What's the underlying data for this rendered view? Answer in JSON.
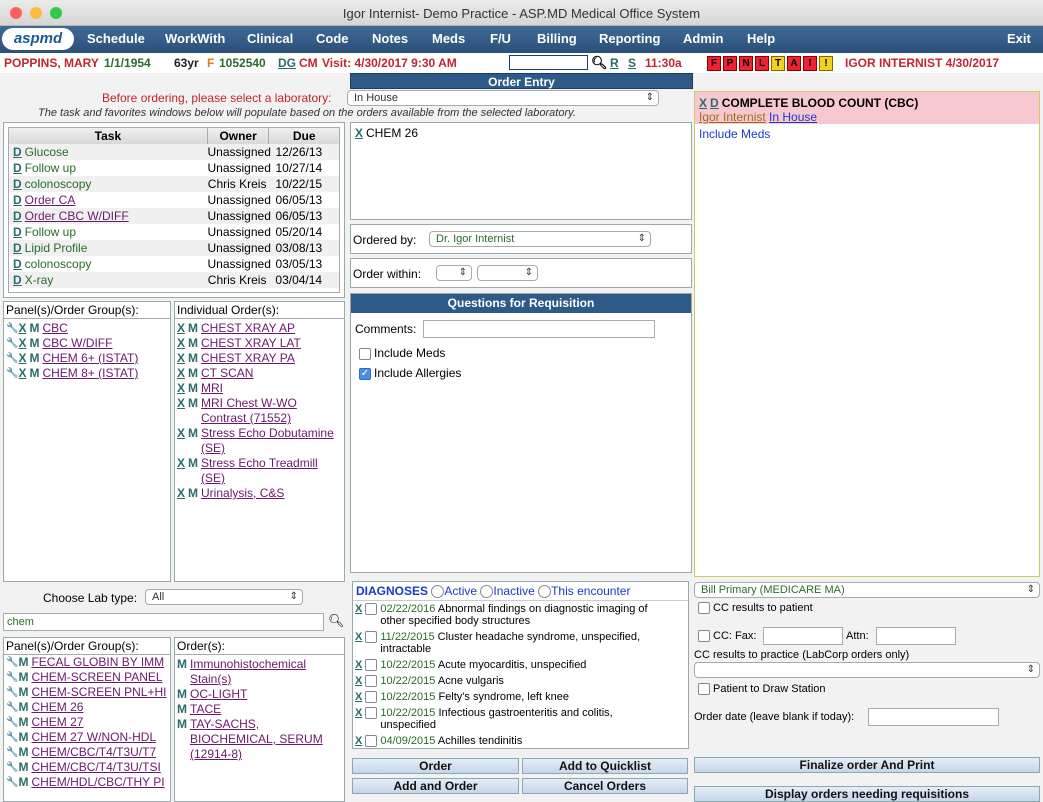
{
  "window": {
    "title": "Igor Internist- Demo Practice - ASP.MD Medical Office System"
  },
  "logo": "aspmd",
  "menu": [
    "Schedule",
    "WorkWith",
    "Clinical",
    "Code",
    "Notes",
    "Meds",
    "F/U",
    "Billing",
    "Reporting",
    "Admin",
    "Help",
    "Exit"
  ],
  "patient": {
    "name": "POPPINS, MARY",
    "dob": "1/1/1954",
    "age": "63yr",
    "sex": "F",
    "id": "1052540",
    "dg": "DG",
    "cm": "CM",
    "visit": "Visit: 4/30/2017 9:30 AM",
    "r": "R",
    "s": "S",
    "time": "11:30a",
    "flags": [
      "F",
      "P",
      "N",
      "L",
      "T",
      "A",
      "I",
      "!"
    ],
    "provider": "IGOR INTERNIST 4/30/2017"
  },
  "order_entry": {
    "title": "Order Entry",
    "lab_prompt": "Before ordering, please select a laboratory:",
    "lab_value": "In House",
    "lab_note": "The task and favorites windows below will populate based on the orders available from the selected laboratory."
  },
  "task_table": {
    "headers": [
      "Task",
      "Owner",
      "Due"
    ],
    "rows": [
      {
        "task": "Glucose",
        "owner": "Unassigned",
        "due": "12/26/13",
        "link": false
      },
      {
        "task": "Follow up",
        "owner": "Unassigned",
        "due": "10/27/14",
        "link": false
      },
      {
        "task": "colonoscopy",
        "owner": "Chris Kreis",
        "due": "10/22/15",
        "link": false
      },
      {
        "task": "Order CA",
        "owner": "Unassigned",
        "due": "06/05/13",
        "link": true
      },
      {
        "task": "Order CBC W/DIFF",
        "owner": "Unassigned",
        "due": "06/05/13",
        "link": true
      },
      {
        "task": "Follow up",
        "owner": "Unassigned",
        "due": "05/20/14",
        "link": false
      },
      {
        "task": "Lipid Profile",
        "owner": "Unassigned",
        "due": "03/08/13",
        "link": false
      },
      {
        "task": "colonoscopy",
        "owner": "Unassigned",
        "due": "03/05/13",
        "link": false
      },
      {
        "task": "X-ray",
        "owner": "Chris Kreis",
        "due": "03/04/14",
        "link": false
      }
    ]
  },
  "panels": {
    "label": "Panel(s)/Order Group(s):",
    "items": [
      "CBC",
      "CBC W/DIFF",
      "CHEM 6+ (ISTAT)",
      "CHEM 8+ (ISTAT)"
    ]
  },
  "individual": {
    "label": "Individual Order(s):",
    "items": [
      "CHEST XRAY AP",
      "CHEST XRAY LAT",
      "CHEST XRAY PA",
      "CT SCAN",
      "MRI",
      "MRI Chest W-WO Contrast (71552)",
      "Stress Echo Dobutamine (SE)",
      "Stress Echo Treadmill (SE)",
      "Urinalysis, C&S"
    ]
  },
  "selected_item": "CHEM 26",
  "ordered_by": {
    "label": "Ordered by:",
    "value": "Dr. Igor Internist"
  },
  "order_within": {
    "label": "Order within:"
  },
  "questions": {
    "title": "Questions for Requisition",
    "comments": "Comments:",
    "include_meds": "Include Meds",
    "include_allergies": "Include Allergies"
  },
  "cart": {
    "x": "X",
    "d": "D",
    "title": "COMPLETE BLOOD COUNT (CBC)",
    "provider": "Igor Internist",
    "lab": "In House",
    "include_meds": "Include Meds"
  },
  "lab_type": {
    "label": "Choose Lab type:",
    "value": "All"
  },
  "search": {
    "value": "chem"
  },
  "search_panels": {
    "label": "Panel(s)/Order Group(s):",
    "items": [
      "FECAL GLOBIN BY IMM",
      "CHEM-SCREEN PANEL",
      "CHEM-SCREEN PNL+HI",
      "CHEM 26",
      "CHEM 27",
      "CHEM 27 W/NON-HDL",
      "CHEM/CBC/T4/T3U/T7",
      "CHEM/CBC/T4/T3U/TSI",
      "CHEM/HDL/CBC/THY PI"
    ]
  },
  "search_orders": {
    "label": "Order(s):",
    "items": [
      "Immunohistochemical Stain(s)",
      "OC-LIGHT",
      "TACE",
      "TAY-SACHS, BIOCHEMICAL, SERUM (12914-8)"
    ]
  },
  "diagnoses": {
    "title": "DIAGNOSES",
    "opt_active": "Active",
    "opt_inactive": "Inactive",
    "opt_encounter": "This encounter",
    "items": [
      {
        "date": "02/22/2016",
        "text": "Abnormal findings on diagnostic imaging of other specified body structures"
      },
      {
        "date": "11/22/2015",
        "text": "Cluster headache syndrome, unspecified, intractable"
      },
      {
        "date": "10/22/2015",
        "text": "Acute myocarditis, unspecified"
      },
      {
        "date": "10/22/2015",
        "text": "Acne vulgaris"
      },
      {
        "date": "10/22/2015",
        "text": "Felty's syndrome, left knee"
      },
      {
        "date": "10/22/2015",
        "text": "Infectious gastroenteritis and colitis, unspecified"
      },
      {
        "date": "04/09/2015",
        "text": "Achilles tendinitis"
      }
    ]
  },
  "billing": {
    "value": "Bill Primary (MEDICARE MA)",
    "cc_patient": "CC results to patient",
    "cc_fax": "CC: Fax:",
    "attn": "Attn:",
    "cc_practice": "CC results to practice (LabCorp orders only)",
    "draw": "Patient to Draw Station",
    "order_date": "Order date (leave blank if today):"
  },
  "buttons": {
    "order": "Order",
    "add_quick": "Add to Quicklist",
    "add_order": "Add and Order",
    "cancel": "Cancel Orders",
    "finalize": "Finalize order And Print",
    "display": "Display orders needing requisitions"
  }
}
